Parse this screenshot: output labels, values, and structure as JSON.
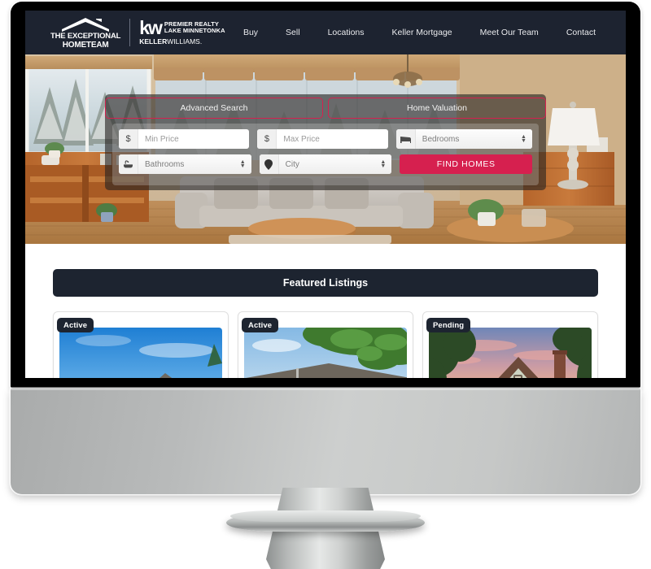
{
  "brand": {
    "logo_line1": "THE EXCEPTIONAL",
    "logo_line2": "HOMETEAM",
    "roof_icon": "house-roof-icon",
    "kw_mark": "kw",
    "kw_line1": "PREMIER REALTY",
    "kw_line2": "LAKE MINNETONKA",
    "kw_keller": "KELLER",
    "kw_williams": "WILLIAMS.",
    "nav_bg": "#1d2330"
  },
  "nav": {
    "items": [
      {
        "label": "Buy"
      },
      {
        "label": "Sell"
      },
      {
        "label": "Locations"
      },
      {
        "label": "Keller Mortgage"
      },
      {
        "label": "Meet Our Team"
      },
      {
        "label": "Contact"
      }
    ]
  },
  "hero": {
    "tabs": [
      {
        "label": "Advanced Search",
        "active": true
      },
      {
        "label": "Home Valuation",
        "active": false
      }
    ],
    "tab_border_color": "#d6204f",
    "search_form": {
      "min_price": {
        "placeholder": "Min Price",
        "value": "",
        "icon": "dollar-icon"
      },
      "max_price": {
        "placeholder": "Max Price",
        "value": "",
        "icon": "dollar-icon"
      },
      "bedrooms": {
        "placeholder": "Bedrooms",
        "value": "Bedrooms",
        "icon": "bed-icon"
      },
      "bathrooms": {
        "placeholder": "Bathrooms",
        "value": "Bathrooms",
        "icon": "bathtub-icon"
      },
      "city": {
        "placeholder": "City",
        "value": "City",
        "icon": "map-pin-icon"
      },
      "submit_label": "FIND HOMES",
      "submit_color": "#d6204f"
    }
  },
  "featured": {
    "title": "Featured Listings",
    "title_bg": "#1d2430",
    "listings": [
      {
        "status": "Active",
        "image": "two-story-house-blue-sky-photo"
      },
      {
        "status": "Active",
        "image": "ranch-house-with-tree-photo"
      },
      {
        "status": "Pending",
        "image": "house-at-sunset-photo"
      }
    ]
  }
}
